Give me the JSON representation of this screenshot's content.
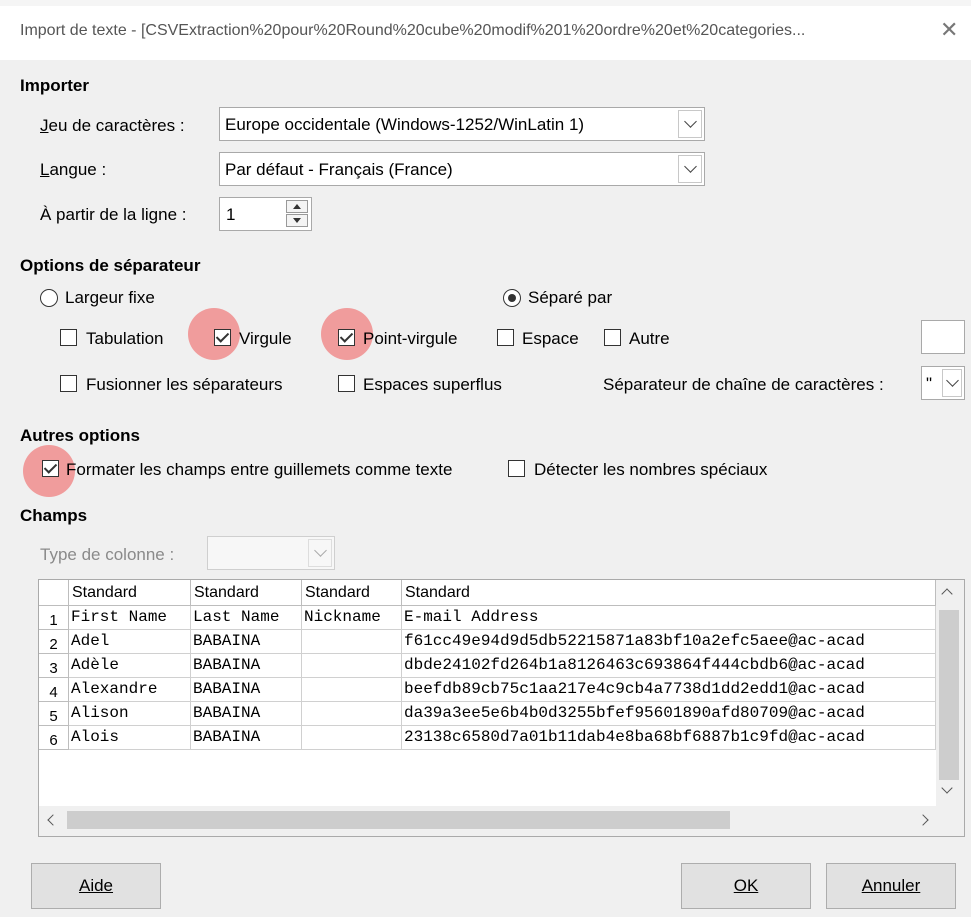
{
  "window": {
    "title": "Import de texte - [CSVExtraction%20pour%20Round%20cube%20modif%201%20ordre%20et%20categories...",
    "close_glyph": "✕"
  },
  "importer": {
    "heading": "Importer",
    "charset_label": "Jeu de caractères :",
    "charset_value": "Europe occidentale (Windows-1252/WinLatin 1)",
    "language_label": "Langue :",
    "language_value": "Par défaut - Français (France)",
    "from_line_label": "À partir de la ligne :",
    "from_line_value": "1"
  },
  "separator": {
    "heading": "Options de séparateur",
    "fixed_width_label": "Largeur fixe",
    "separated_by_label": "Séparé par",
    "separated_by_selected": true,
    "tab_label": "Tabulation",
    "tab_checked": false,
    "comma_label": "Virgule",
    "comma_checked": true,
    "semicolon_label": "Point-virgule",
    "semicolon_checked": true,
    "space_label": "Espace",
    "space_checked": false,
    "other_label": "Autre",
    "other_checked": false,
    "merge_label": "Fusionner les séparateurs",
    "merge_checked": false,
    "trim_label": "Espaces superflus",
    "trim_checked": false,
    "string_delim_label": "Séparateur de chaîne de caractères :",
    "string_delim_value": "\""
  },
  "other_options": {
    "heading": "Autres options",
    "quoted_as_text_label": "Formater les champs entre guillemets comme texte",
    "quoted_as_text_checked": true,
    "detect_special_label": "Détecter les nombres spéciaux",
    "detect_special_checked": false
  },
  "fields": {
    "heading": "Champs",
    "column_type_label": "Type de colonne :",
    "column_type_value": "",
    "headers": [
      "Standard",
      "Standard",
      "Standard",
      "Standard"
    ],
    "rows": [
      {
        "num": "1",
        "cells": [
          "First Name",
          "Last Name",
          "Nickname",
          "E-mail Address"
        ]
      },
      {
        "num": "2",
        "cells": [
          "Adel",
          "BABAINA",
          "",
          "f61cc49e94d9d5db52215871a83bf10a2efc5aee@ac-acad"
        ]
      },
      {
        "num": "3",
        "cells": [
          "Adèle",
          "BABAINA",
          "",
          "dbde24102fd264b1a8126463c693864f444cbdb6@ac-acad"
        ]
      },
      {
        "num": "4",
        "cells": [
          "Alexandre",
          "BABAINA",
          "",
          "beefdb89cb75c1aa217e4c9cb4a7738d1dd2edd1@ac-acad"
        ]
      },
      {
        "num": "5",
        "cells": [
          "Alison",
          "BABAINA",
          "",
          "da39a3ee5e6b4b0d3255bfef95601890afd80709@ac-acad"
        ]
      },
      {
        "num": "6",
        "cells": [
          "Alois",
          "BABAINA",
          "",
          "23138c6580d7a01b11dab4e8ba68bf6887b1c9fd@ac-acad"
        ]
      }
    ]
  },
  "buttons": {
    "help": "Aide",
    "ok": "OK",
    "cancel": "Annuler"
  },
  "colors": {
    "highlight": "#f07878",
    "dialog_bg": "#f0f0f0"
  }
}
